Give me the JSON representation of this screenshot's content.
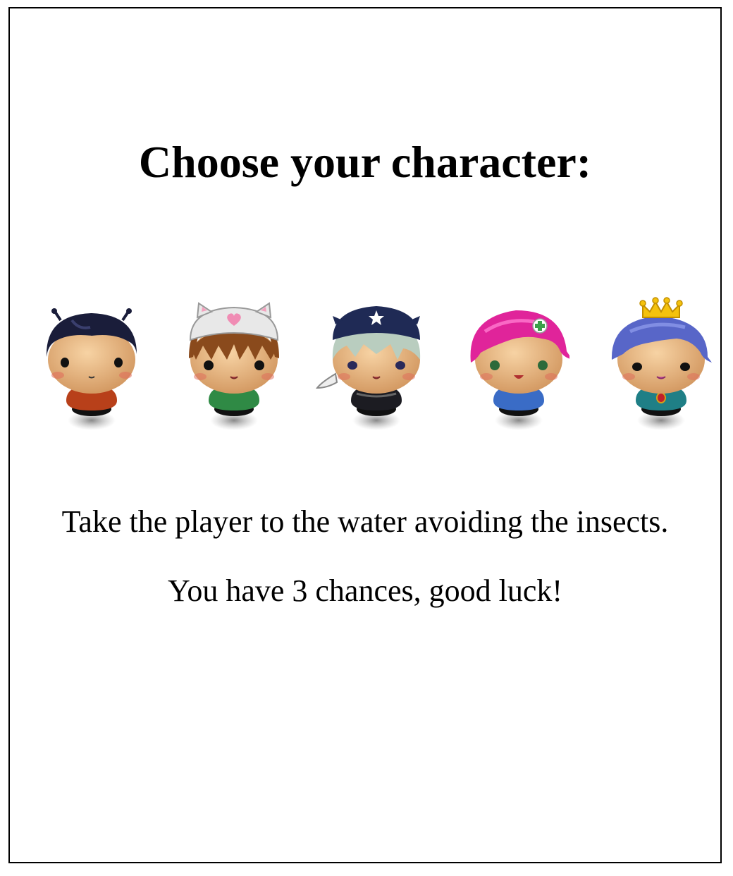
{
  "heading": "Choose your character:",
  "characters": [
    {
      "id": "boy-antennae",
      "hair": "#1a1d3a",
      "body": "#b8401a"
    },
    {
      "id": "cat-hat-kid",
      "hair": "#8a4a1c",
      "body": "#2f8a45"
    },
    {
      "id": "ninja-kid",
      "hair": "#b9cdbf",
      "body": "#1c1c22"
    },
    {
      "id": "pink-hair-girl",
      "hair": "#e0249a",
      "body": "#3a6cc6"
    },
    {
      "id": "princess",
      "hair": "#5866c8",
      "body": "#1f7f86"
    }
  ],
  "instructions": {
    "line1": "Take the player to the water avoiding the insects.",
    "line2": "You have 3 chances, good luck!"
  }
}
